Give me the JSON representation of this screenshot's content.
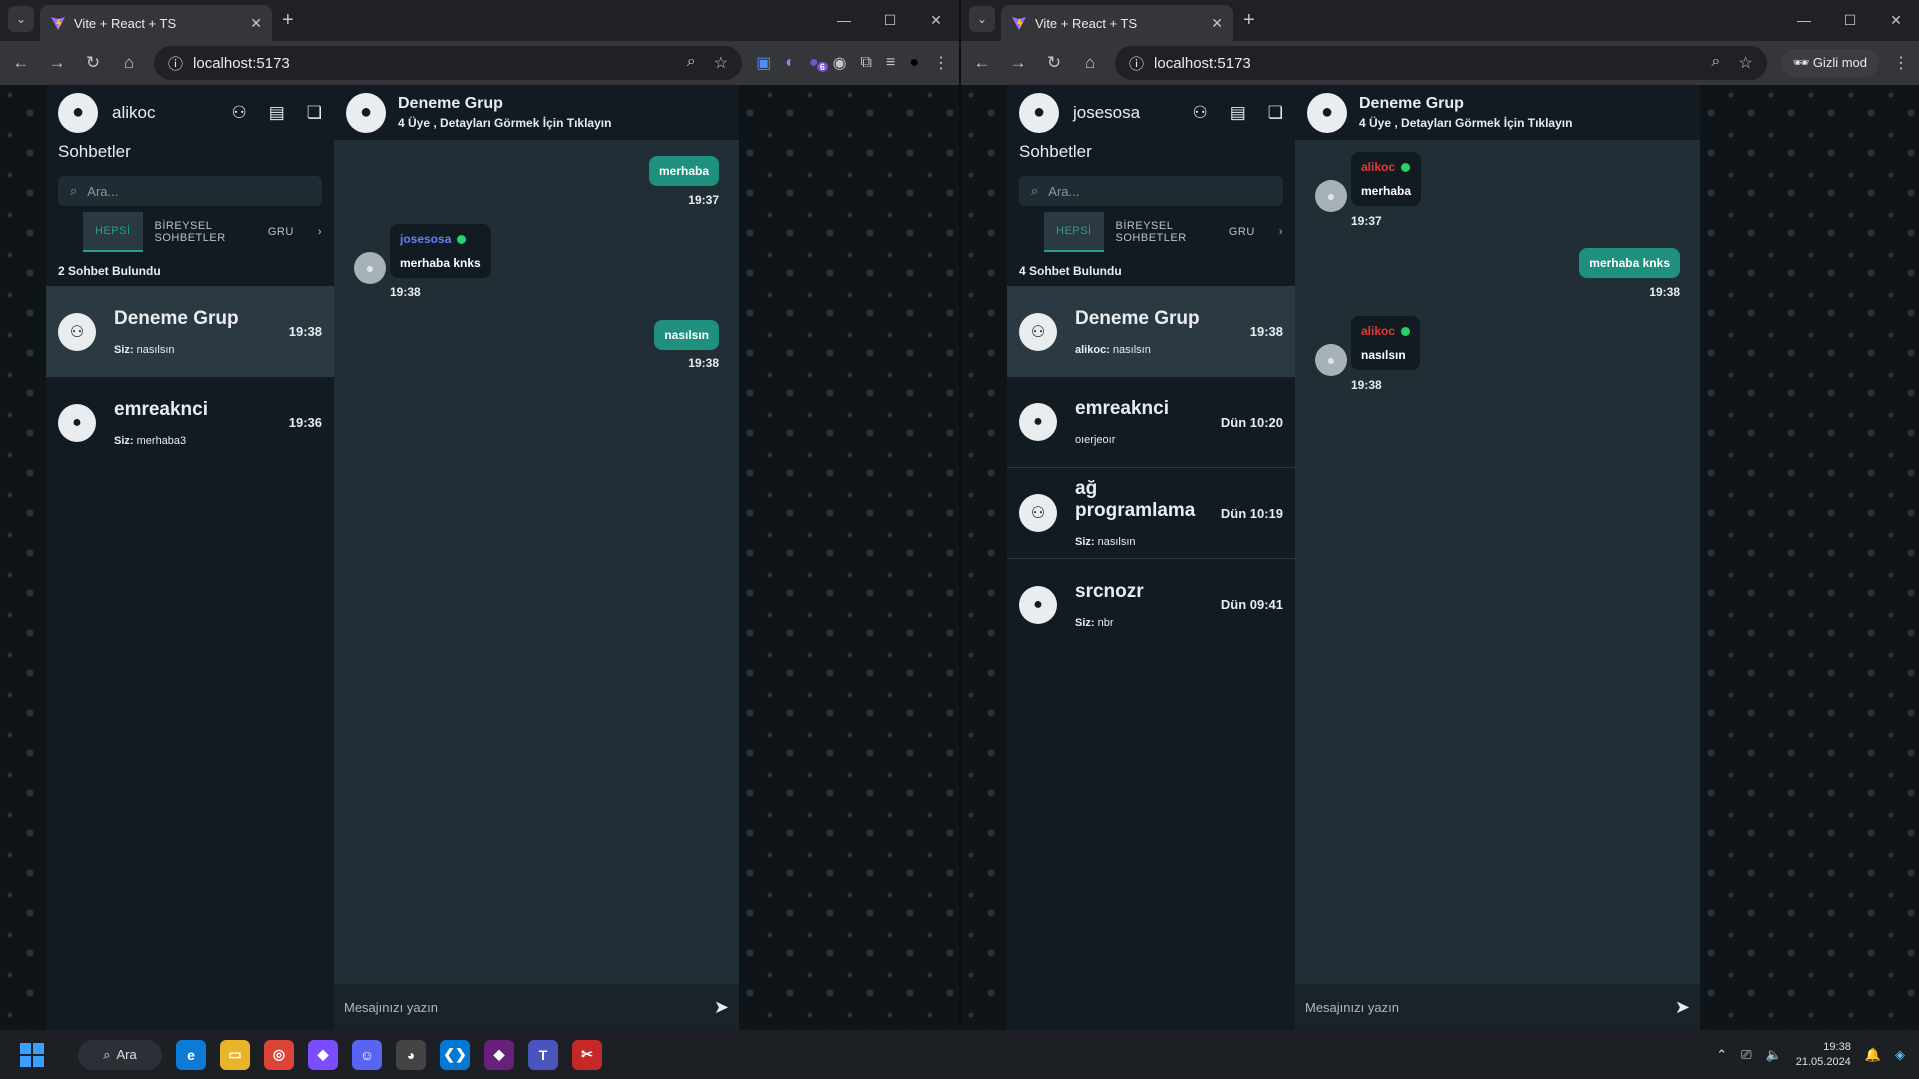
{
  "left": {
    "tab_title": "Vite + React + TS",
    "url": "localhost:5173",
    "user": "alikoc",
    "sidebar_title": "Sohbetler",
    "search_placeholder": "Ara...",
    "tabs": [
      "HEPSİ",
      "BİREYSEL SOHBETLER",
      "GRU"
    ],
    "found": "2 Sohbet Bulundu",
    "chats": [
      {
        "name": "Deneme Grup",
        "time": "19:38",
        "prefix": "Siz:",
        "last": "nasılsın"
      },
      {
        "name": "emreaknci",
        "time": "19:36",
        "prefix": "Siz:",
        "last": "merhaba3"
      }
    ],
    "group_title": "Deneme Grup",
    "group_sub": "4 Üye , Detayları Görmek İçin Tıklayın",
    "messages": [
      {
        "text": "merhaba",
        "time": "19:37"
      },
      {
        "sender": "josesosa",
        "text": "merhaba knks",
        "time": "19:38"
      },
      {
        "text": "nasılsın",
        "time": "19:38"
      }
    ],
    "composer_placeholder": "Mesajınızı yazın",
    "badge": "6"
  },
  "right": {
    "tab_title": "Vite + React + TS",
    "url": "localhost:5173",
    "incognito": "Gizli mod",
    "user": "josesosa",
    "sidebar_title": "Sohbetler",
    "search_placeholder": "Ara...",
    "tabs": [
      "HEPSİ",
      "BİREYSEL SOHBETLER",
      "GRU"
    ],
    "found": "4 Sohbet Bulundu",
    "chats": [
      {
        "name": "Deneme Grup",
        "time": "19:38",
        "prefix": "alikoc:",
        "last": "nasılsın"
      },
      {
        "name": "emreaknci",
        "time": "Dün 10:20",
        "prefix": "",
        "last": "oıerjeoır"
      },
      {
        "name": "ağ programlama",
        "time": "Dün 10:19",
        "prefix": "Siz:",
        "last": "nasılsın"
      },
      {
        "name": "srcnozr",
        "time": "Dün 09:41",
        "prefix": "Siz:",
        "last": "nbr"
      }
    ],
    "group_title": "Deneme Grup",
    "group_sub": "4 Üye , Detayları Görmek İçin Tıklayın",
    "messages": [
      {
        "sender": "alikoc",
        "text": "merhaba",
        "time": "19:37"
      },
      {
        "text": "merhaba knks",
        "time": "19:38"
      },
      {
        "sender": "alikoc",
        "text": "nasılsın",
        "time": "19:38"
      }
    ],
    "composer_placeholder": "Mesajınızı yazın"
  },
  "taskbar": {
    "search": "Ara",
    "time": "19:38",
    "date": "21.05.2024"
  },
  "colors": {
    "accent": "#1f8f7e",
    "sender_left": "#6b7cff",
    "sender_right": "#e53935",
    "online": "#25d366"
  }
}
